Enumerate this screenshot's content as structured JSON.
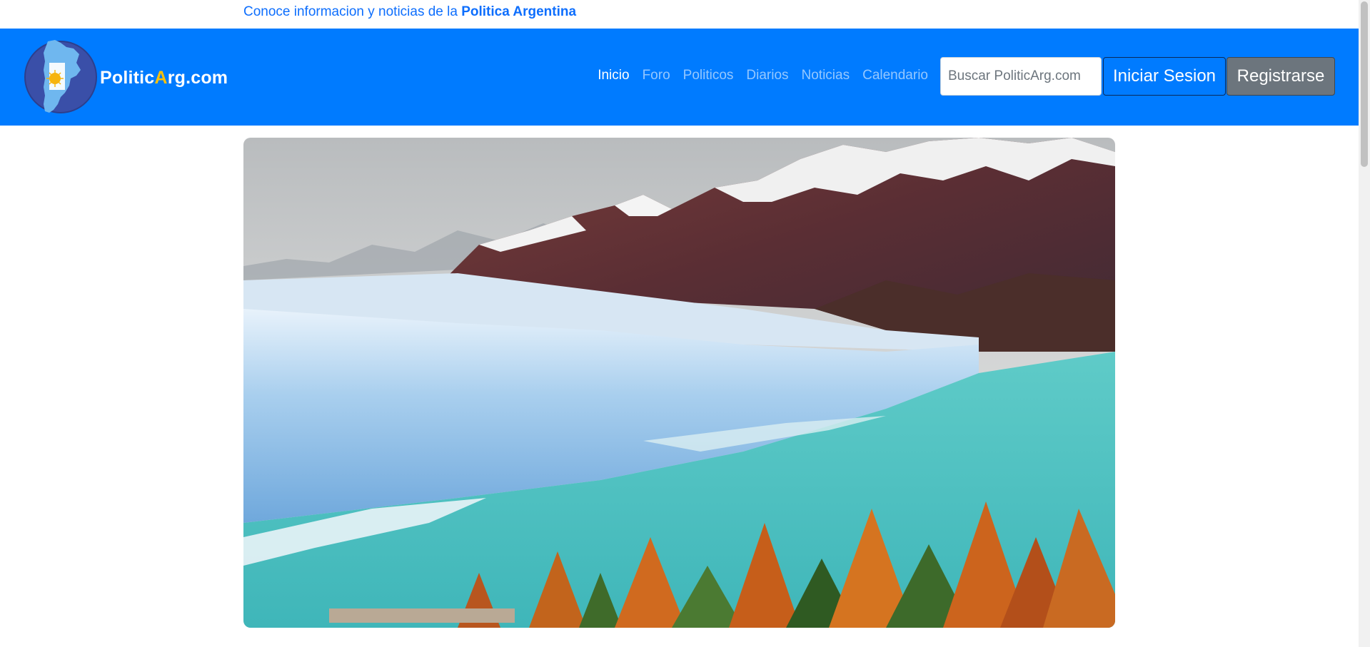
{
  "topbar": {
    "message_prefix": "Conoce informacion y noticias de la ",
    "message_highlight": "Politica Argentina"
  },
  "brand": {
    "part1": "Politic",
    "part2": "A",
    "part3": "rg.com"
  },
  "nav": {
    "items": [
      {
        "label": "Inicio",
        "active": true
      },
      {
        "label": "Foro",
        "active": false
      },
      {
        "label": "Politicos",
        "active": false
      },
      {
        "label": "Diarios",
        "active": false
      },
      {
        "label": "Noticias",
        "active": false
      },
      {
        "label": "Calendario",
        "active": false
      }
    ]
  },
  "search": {
    "placeholder": "Buscar PoliticArg.com"
  },
  "buttons": {
    "login": "Iniciar Sesion",
    "register": "Registrarse"
  },
  "colors": {
    "navbar": "#007bff",
    "accent": "#ffc107",
    "link": "#0d6efd",
    "register_button": "#6c757d"
  },
  "hero": {
    "image_icon": "glacier-landscape-photo"
  }
}
